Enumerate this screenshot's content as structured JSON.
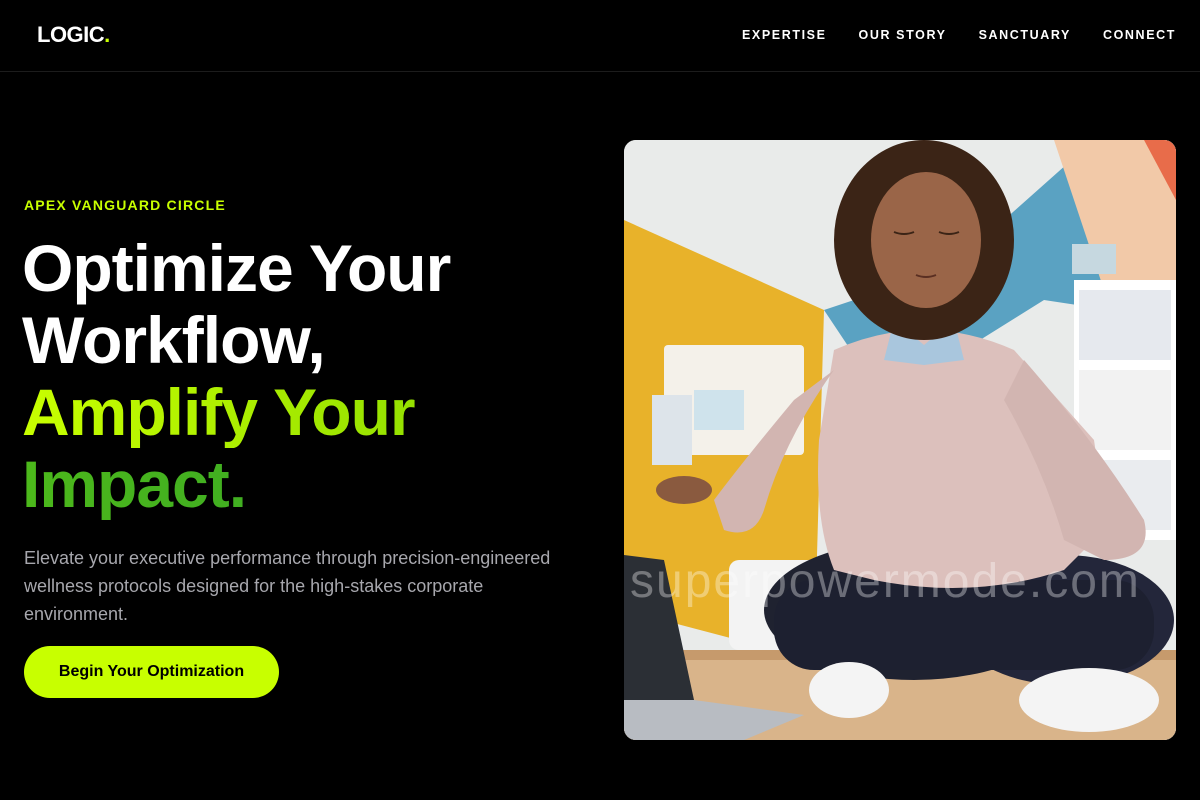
{
  "brand": {
    "name": "LOGIC",
    "dot": "."
  },
  "nav": [
    {
      "label": "EXPERTISE"
    },
    {
      "label": "OUR STORY"
    },
    {
      "label": "SANCTUARY"
    },
    {
      "label": "CONNECT"
    }
  ],
  "hero": {
    "eyebrow": "APEX VANGUARD CIRCLE",
    "headline": {
      "line1": "Optimize Your",
      "line2": "Workflow,",
      "line3": "Amplify Your",
      "line4": "Impact."
    },
    "subcopy": "Elevate your executive performance through precision-engineered wellness protocols designed for the high-stakes corporate environment.",
    "cta_label": "Begin Your Optimization",
    "image_watermark": "superpowermode.com"
  },
  "colors": {
    "background": "#000000",
    "accent": "#c8ff00",
    "accent_dark": "#2fa02a",
    "muted_text": "#a7a7ad"
  }
}
